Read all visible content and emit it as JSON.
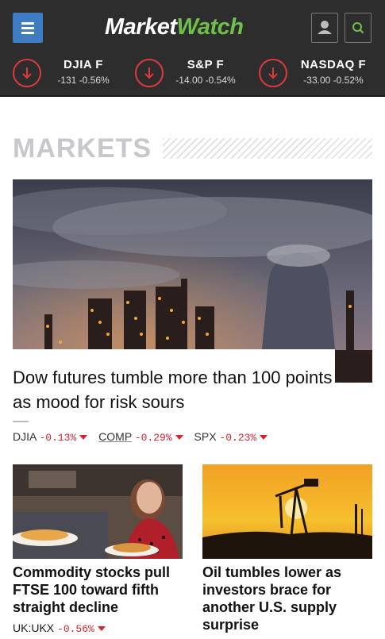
{
  "header": {
    "logo_part1": "Market",
    "logo_part2": "Watch",
    "colors": {
      "bar": "#2d2d2d",
      "menu": "#3e7cc4",
      "logo_accent": "#6fc04a",
      "down": "#e0393e"
    },
    "tickers": [
      {
        "name": "DJIA F",
        "change": "-131 -0.56%",
        "direction": "down"
      },
      {
        "name": "S&P F",
        "change": "-14.00 -0.54%",
        "direction": "down"
      },
      {
        "name": "NASDAQ F",
        "change": "-33.00 -0.52%",
        "direction": "down"
      }
    ],
    "icons": [
      "menu-icon",
      "user-icon",
      "search-icon",
      "down-arrow-icon"
    ]
  },
  "section": {
    "title": "MARKETS"
  },
  "hero": {
    "headline": "Dow futures tumble more than 100 points as mood for risk sours",
    "quotes": [
      {
        "symbol": "DJIA",
        "change": "-0.13%"
      },
      {
        "symbol": "COMP",
        "change": "-0.29%"
      },
      {
        "symbol": "SPX",
        "change": "-0.23%"
      }
    ]
  },
  "cards": [
    {
      "headline": "Commodity stocks pull FTSE 100 toward fifth straight decline",
      "quote": {
        "symbol": "UK:UKX",
        "change": "-0.56%"
      }
    },
    {
      "headline": "Oil tumbles lower as investors brace for another U.S. supply surprise"
    }
  ]
}
